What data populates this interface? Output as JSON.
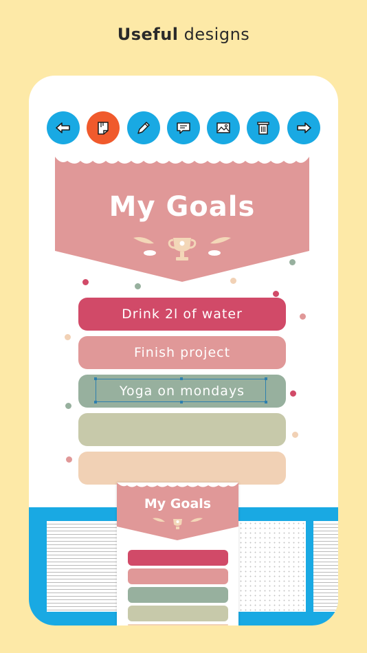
{
  "headline": {
    "bold": "Useful",
    "rest": " designs"
  },
  "toolbar": {
    "buttons": [
      {
        "icon": "back-arrow-icon",
        "color": "#19a9e3"
      },
      {
        "icon": "sticker-icon",
        "color": "#f05a2c"
      },
      {
        "icon": "pencil-icon",
        "color": "#19a9e3"
      },
      {
        "icon": "speech-bubble-icon",
        "color": "#19a9e3"
      },
      {
        "icon": "image-icon",
        "color": "#19a9e3"
      },
      {
        "icon": "trash-icon",
        "color": "#19a9e3"
      },
      {
        "icon": "forward-arrow-icon",
        "color": "#19a9e3"
      }
    ]
  },
  "banner": {
    "title": "My Goals",
    "color": "#e09898"
  },
  "goals": [
    {
      "text": "Drink 2l of water",
      "color": "#d14a68"
    },
    {
      "text": "Finish project",
      "color": "#e09898"
    },
    {
      "text": "Yoga on mondays",
      "color": "#97b09e",
      "selected": true
    },
    {
      "text": "",
      "color": "#c7c9aa"
    },
    {
      "text": "",
      "color": "#f1d1b5"
    }
  ],
  "template_thumb": {
    "title": "My Goals",
    "rows": [
      "#d14a68",
      "#e09898",
      "#97b09e",
      "#c7c9aa",
      "#f1d1b5"
    ]
  },
  "colors": {
    "background": "#fde9a7",
    "accent": "#19a9e3"
  }
}
